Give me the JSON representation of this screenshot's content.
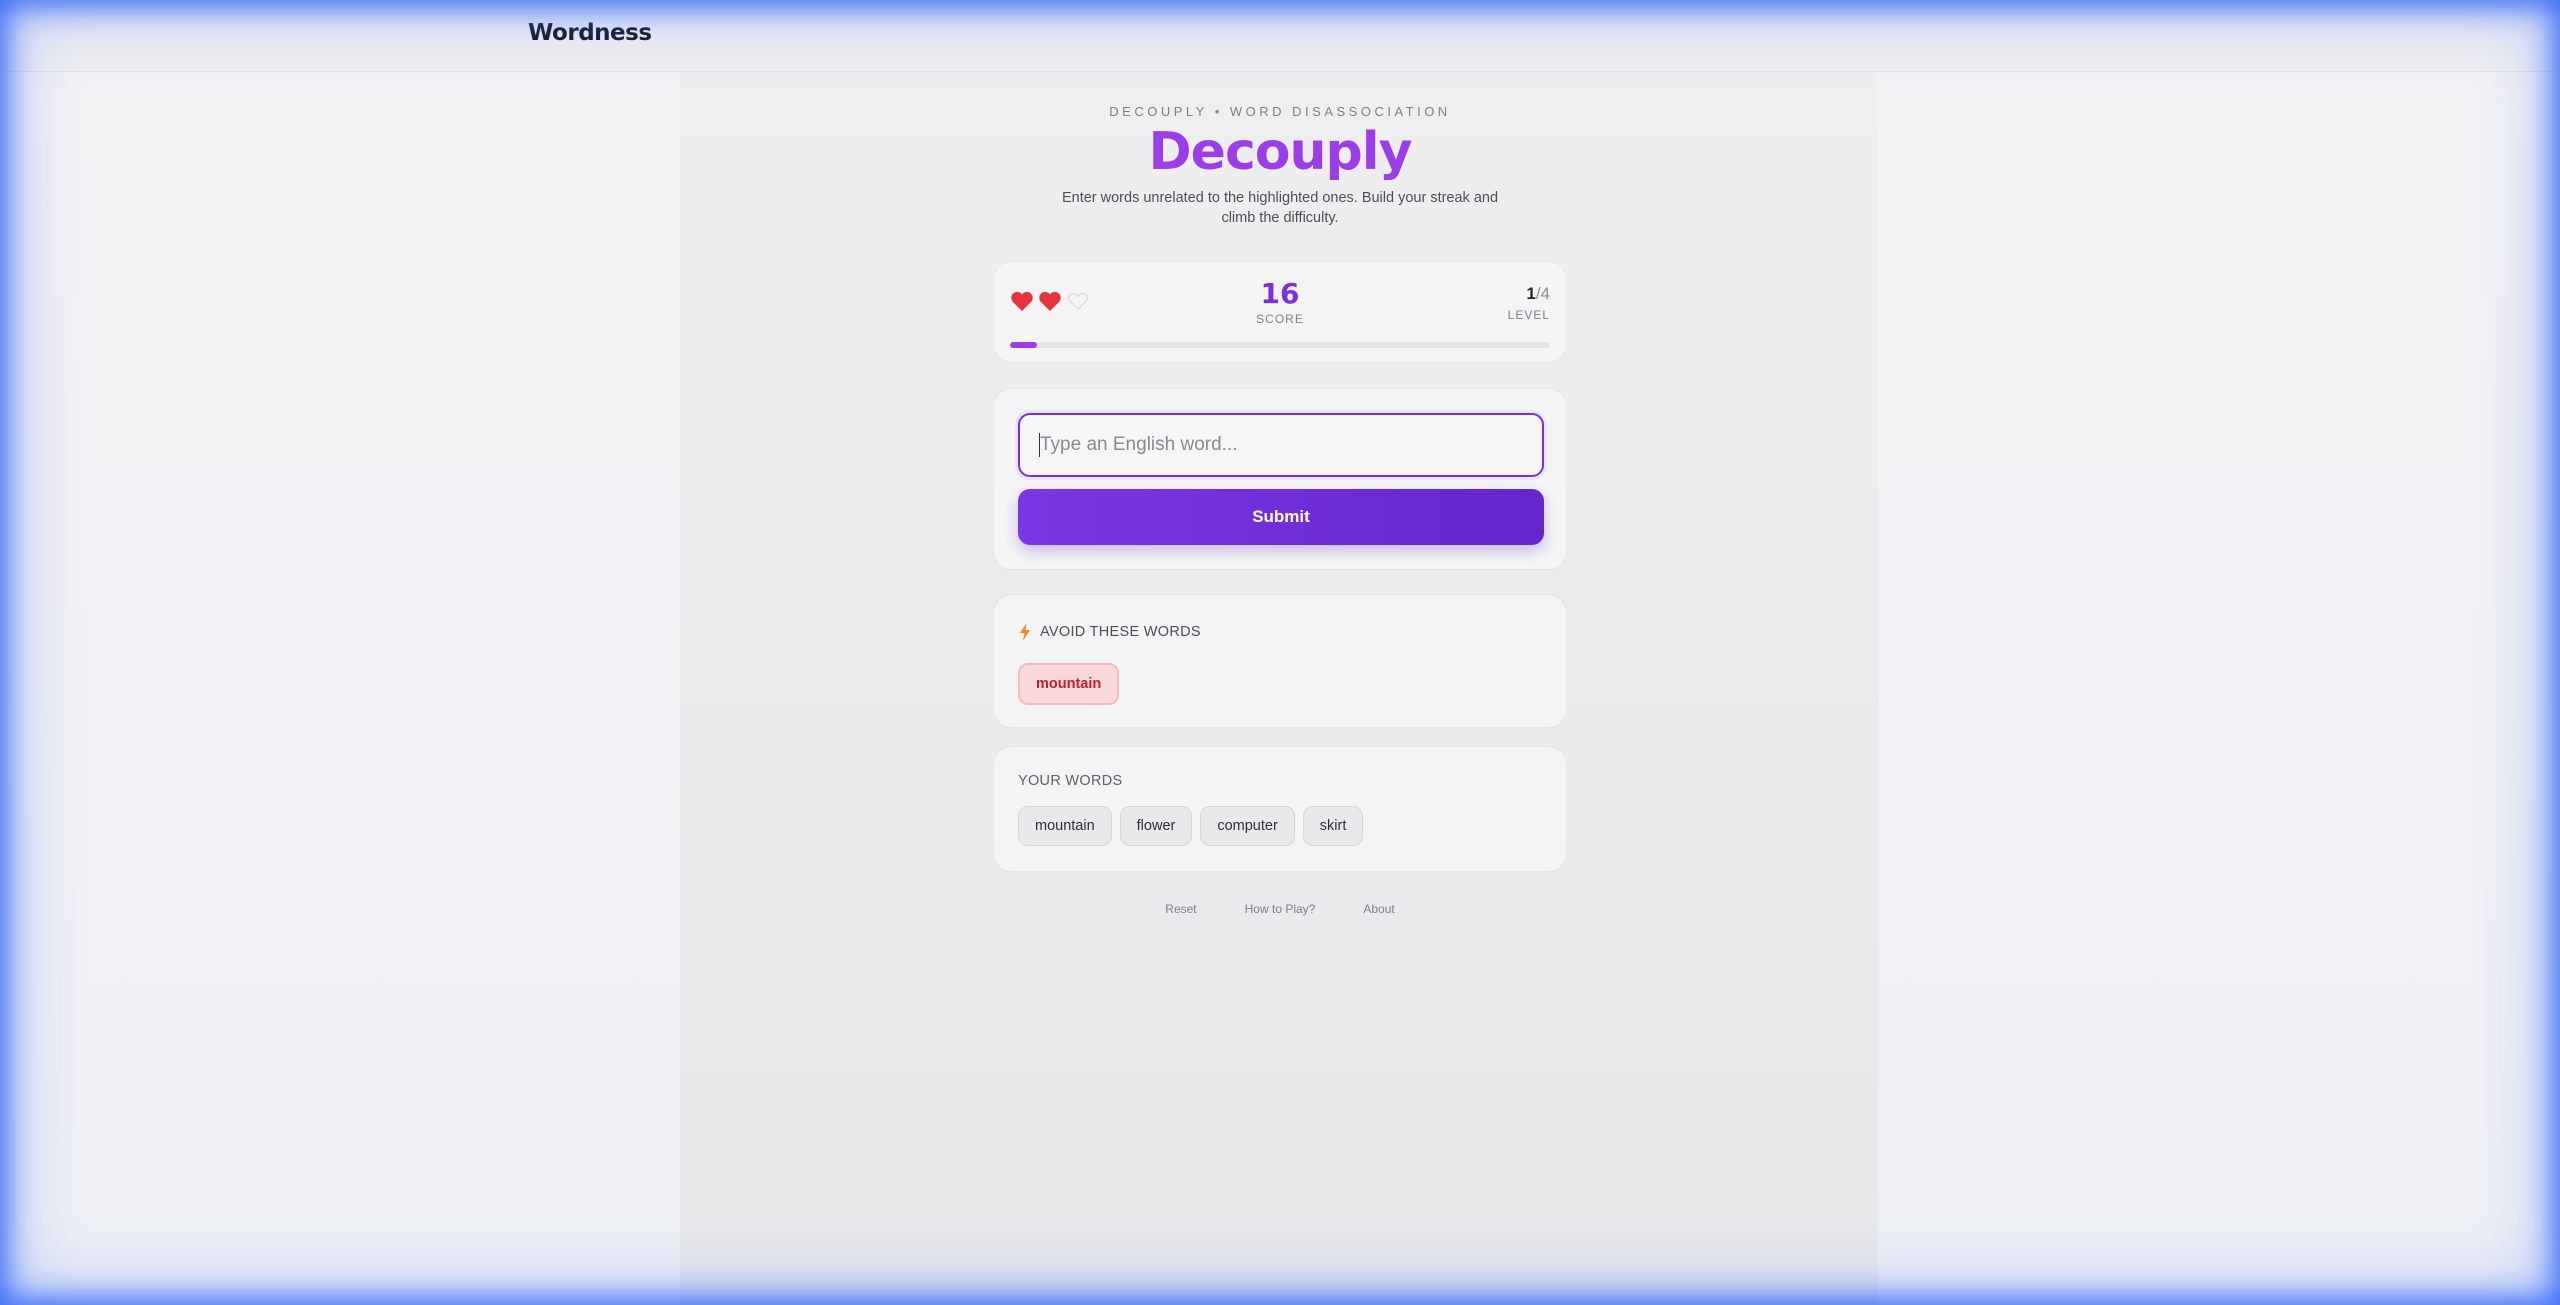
{
  "header": {
    "brand": "Wordness"
  },
  "game": {
    "kicker": "DECOUPLY • WORD DISASSOCIATION",
    "title": "Decouply",
    "subtitle": "Enter words unrelated to the highlighted ones. Build your streak and climb the difficulty."
  },
  "stats": {
    "lives": [
      {
        "state": "full",
        "icon": "heart-icon"
      },
      {
        "state": "full",
        "icon": "heart-icon"
      },
      {
        "state": "empty",
        "icon": "heart-outline-icon"
      }
    ],
    "score": "16",
    "score_label": "SCORE",
    "level_current": "1",
    "level_total": "/4",
    "level_label": "LEVEL",
    "progress_percent": 5
  },
  "input": {
    "placeholder": "Type an English word...",
    "value": "",
    "submit_label": "Submit"
  },
  "avoid": {
    "icon": "lightning-icon",
    "label": "AVOID THESE WORDS",
    "words": [
      "mountain"
    ]
  },
  "your_words": {
    "label": "YOUR WORDS",
    "words": [
      "mountain",
      "flower",
      "computer",
      "skirt"
    ]
  },
  "footer": {
    "links": [
      "Reset",
      "How to Play?",
      "About"
    ]
  },
  "colors": {
    "accent": "#7b2fe0",
    "title": "#9b3ee8",
    "heart": "#e5343d",
    "avoid_text": "#c21d2f",
    "avoid_bg": "#f9d8da"
  }
}
